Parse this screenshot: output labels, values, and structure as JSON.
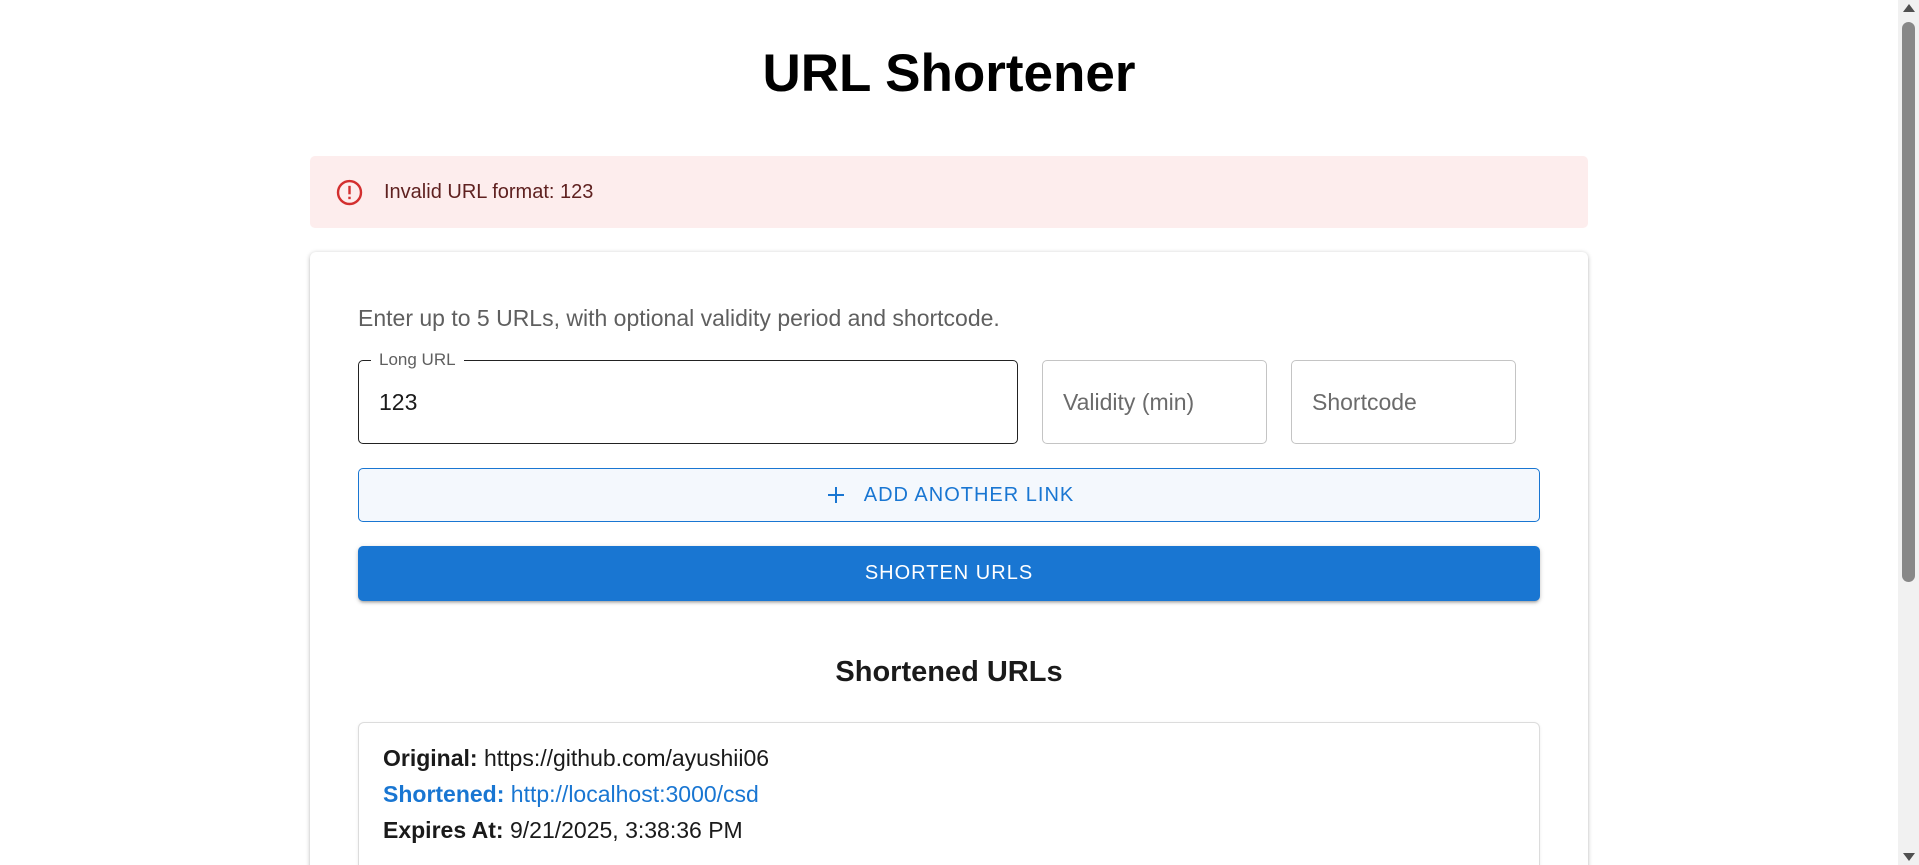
{
  "page": {
    "title": "URL Shortener"
  },
  "alert": {
    "icon": "error-outline-icon",
    "message": "Invalid URL format: 123",
    "color": "#d32f2f",
    "background": "#fdeded"
  },
  "form": {
    "instructions": "Enter up to 5 URLs, with optional validity period and shortcode.",
    "long_url": {
      "label": "Long URL",
      "value": "123"
    },
    "validity": {
      "placeholder": "Validity (min)",
      "value": ""
    },
    "shortcode": {
      "placeholder": "Shortcode",
      "value": ""
    },
    "add_button_label": "ADD ANOTHER LINK",
    "add_button_icon": "plus-icon",
    "submit_button_label": "SHORTEN URLS",
    "accent_color": "#1976d2"
  },
  "results": {
    "heading": "Shortened URLs",
    "items": [
      {
        "original_label": "Original:",
        "original_value": "https://github.com/ayushii06",
        "shortened_label": "Shortened:",
        "shortened_value": "http://localhost:3000/csd",
        "expires_label": "Expires At:",
        "expires_value": "9/21/2025, 3:38:36 PM"
      }
    ]
  }
}
